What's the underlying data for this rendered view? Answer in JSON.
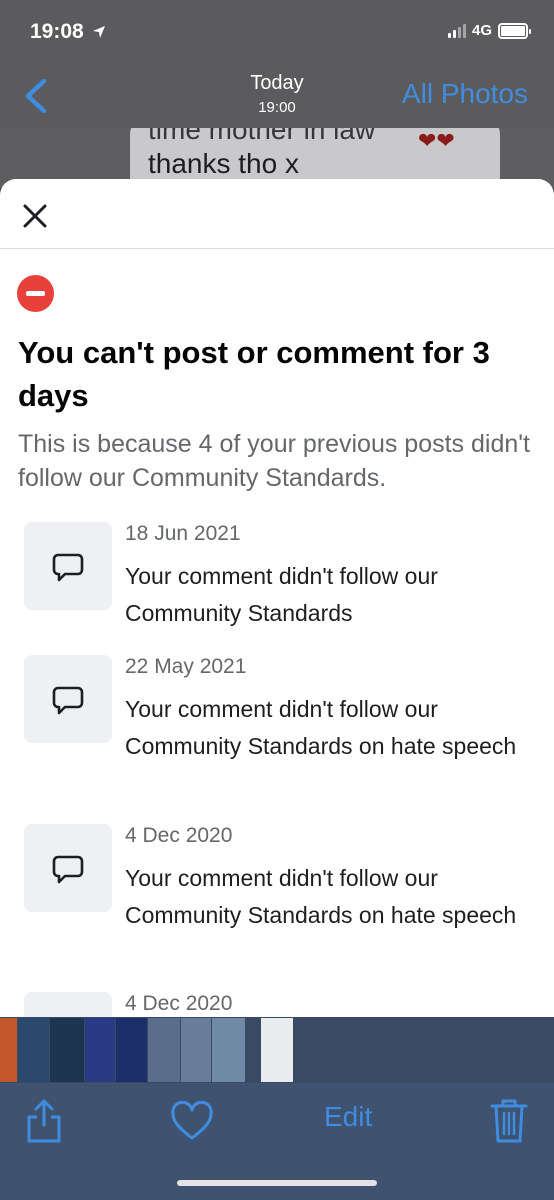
{
  "status_bar": {
    "time": "19:08",
    "network": "4G",
    "battery_level": 1.0
  },
  "nav": {
    "title": "Today",
    "subtitle": "19:00",
    "right_label": "All Photos"
  },
  "background_message": {
    "line1": "time mother in law",
    "line2": "thanks tho x"
  },
  "notice": {
    "headline": "You can't post or comment for 3 days",
    "description": "This is because 4 of your previous posts didn't follow our Community Standards."
  },
  "entries": [
    {
      "date": "18 Jun 2021",
      "text": "Your comment didn't follow our Community Standards"
    },
    {
      "date": "22 May 2021",
      "text": "Your comment didn't follow our Community Standards on hate speech"
    },
    {
      "date": "4 Dec 2020",
      "text": "Your comment didn't follow our Community Standards on hate speech"
    },
    {
      "date": "4 Dec 2020",
      "text": ""
    }
  ],
  "toolbar": {
    "edit_label": "Edit"
  },
  "colors": {
    "accent_blue": "#3f8de0",
    "warning_red": "#e8413c",
    "secondary_text": "#65676b"
  },
  "icons": [
    "location-arrow-icon",
    "signal-icon",
    "battery-icon",
    "chevron-left-icon",
    "close-icon",
    "no-entry-icon",
    "comment-bubble-icon",
    "share-icon",
    "heart-icon",
    "trash-icon"
  ]
}
